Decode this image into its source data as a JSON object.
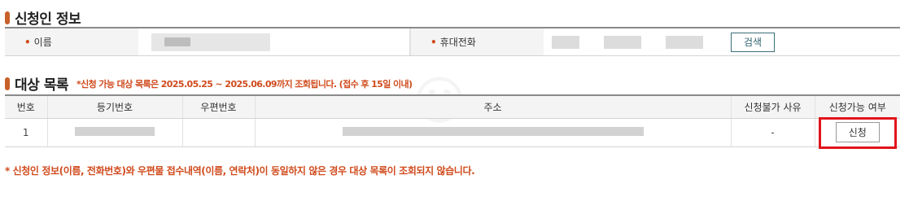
{
  "applicant_section": {
    "title": "신청인 정보",
    "name_label": "이름",
    "phone_label": "휴대전화",
    "search_button": "검색"
  },
  "target_section": {
    "title": "대상 목록",
    "note": "*신청 가능 대상 목록은 2025.05.25 ~ 2025.06.09까지 조회됩니다. (접수 후 15일 이내)",
    "columns": [
      "번호",
      "등기번호",
      "우편번호",
      "주소",
      "신청불가 사유",
      "신청가능 여부"
    ],
    "rows": [
      {
        "no": "1",
        "reason": "-",
        "apply_button": "신청"
      }
    ]
  },
  "footnote": "* 신청인 정보(이름, 전화번호)와 우편물 접수내역(이름, 연락처)이 동일하지 않은 경우 대상 목록이 조회되지 않습니다.",
  "colors": {
    "accent": "#c8602a",
    "note_red": "#d04a1c",
    "highlight_red": "#e1141b",
    "header_bg": "#f4f4f4"
  }
}
